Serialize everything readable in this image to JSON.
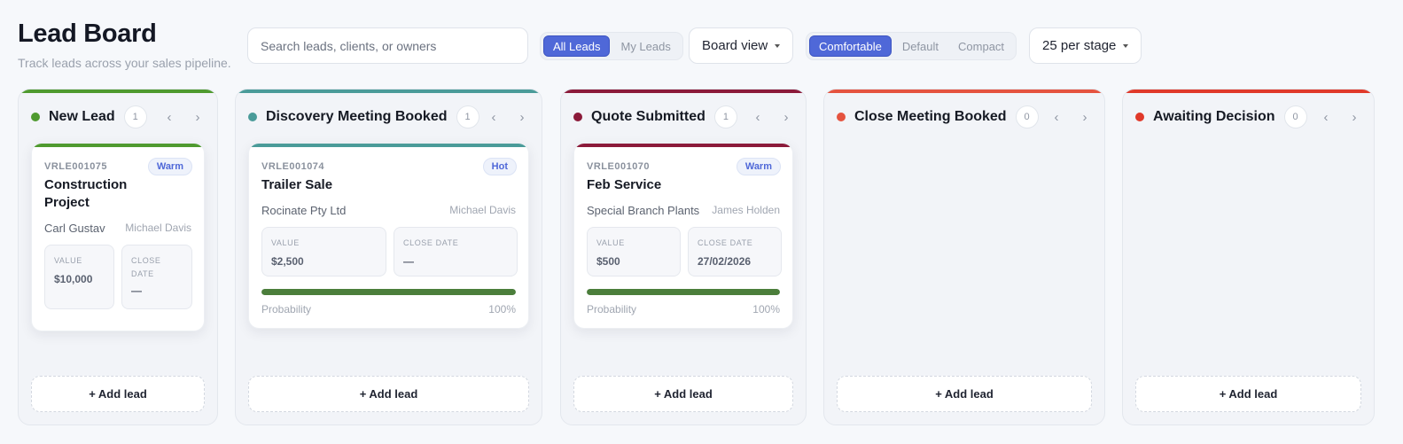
{
  "header": {
    "title": "Lead Board",
    "subtitle": "Track leads across your sales pipeline.",
    "search_placeholder": "Search leads, clients, or owners"
  },
  "filters": {
    "scope": [
      {
        "label": "All Leads",
        "active": true
      },
      {
        "label": "My Leads",
        "active": false
      }
    ],
    "view_label": "Board view",
    "density": [
      {
        "label": "Comfortable",
        "active": true
      },
      {
        "label": "Default",
        "active": false
      },
      {
        "label": "Compact",
        "active": false
      }
    ],
    "per_stage_label": "25 per stage"
  },
  "add_lead_label": "+ Add lead",
  "stages": [
    {
      "name": "New Lead",
      "count": "1",
      "color": "#4f9a2f"
    },
    {
      "name": "Discovery Meeting Booked",
      "count": "1",
      "color": "#4a9b99"
    },
    {
      "name": "Quote Submitted",
      "count": "1",
      "color": "#8b1a3a"
    },
    {
      "name": "Close Meeting Booked",
      "count": "0",
      "color": "#e5533f"
    },
    {
      "name": "Awaiting Decision",
      "count": "0",
      "color": "#e0392a"
    }
  ],
  "cards": [
    {
      "id": "VRLE001075",
      "temp": "Warm",
      "title_line1": "Construction",
      "title_line2": "Project",
      "client": "Carl Gustav",
      "owner": "Michael Davis",
      "value_label": "VALUE",
      "value": "$10,000",
      "close_label_line1": "CLOSE",
      "close_label_line2": "DATE",
      "close": "—"
    },
    {
      "id": "VRLE001074",
      "temp": "Hot",
      "title": "Trailer Sale",
      "client": "Rocinate Pty Ltd",
      "owner": "Michael Davis",
      "value_label": "VALUE",
      "value": "$2,500",
      "close_label": "CLOSE DATE",
      "close": "—",
      "prob_label": "Probability",
      "prob_text": "100%",
      "probability": 1.0
    },
    {
      "id": "VRLE001070",
      "temp": "Warm",
      "title": "Feb Service",
      "client": "Special Branch Plants",
      "owner": "James Holden",
      "value_label": "VALUE",
      "value": "$500",
      "close_label": "CLOSE DATE",
      "close": "27/02/2026",
      "prob_label": "Probability",
      "prob_text": "100%",
      "probability": 1.0
    }
  ]
}
